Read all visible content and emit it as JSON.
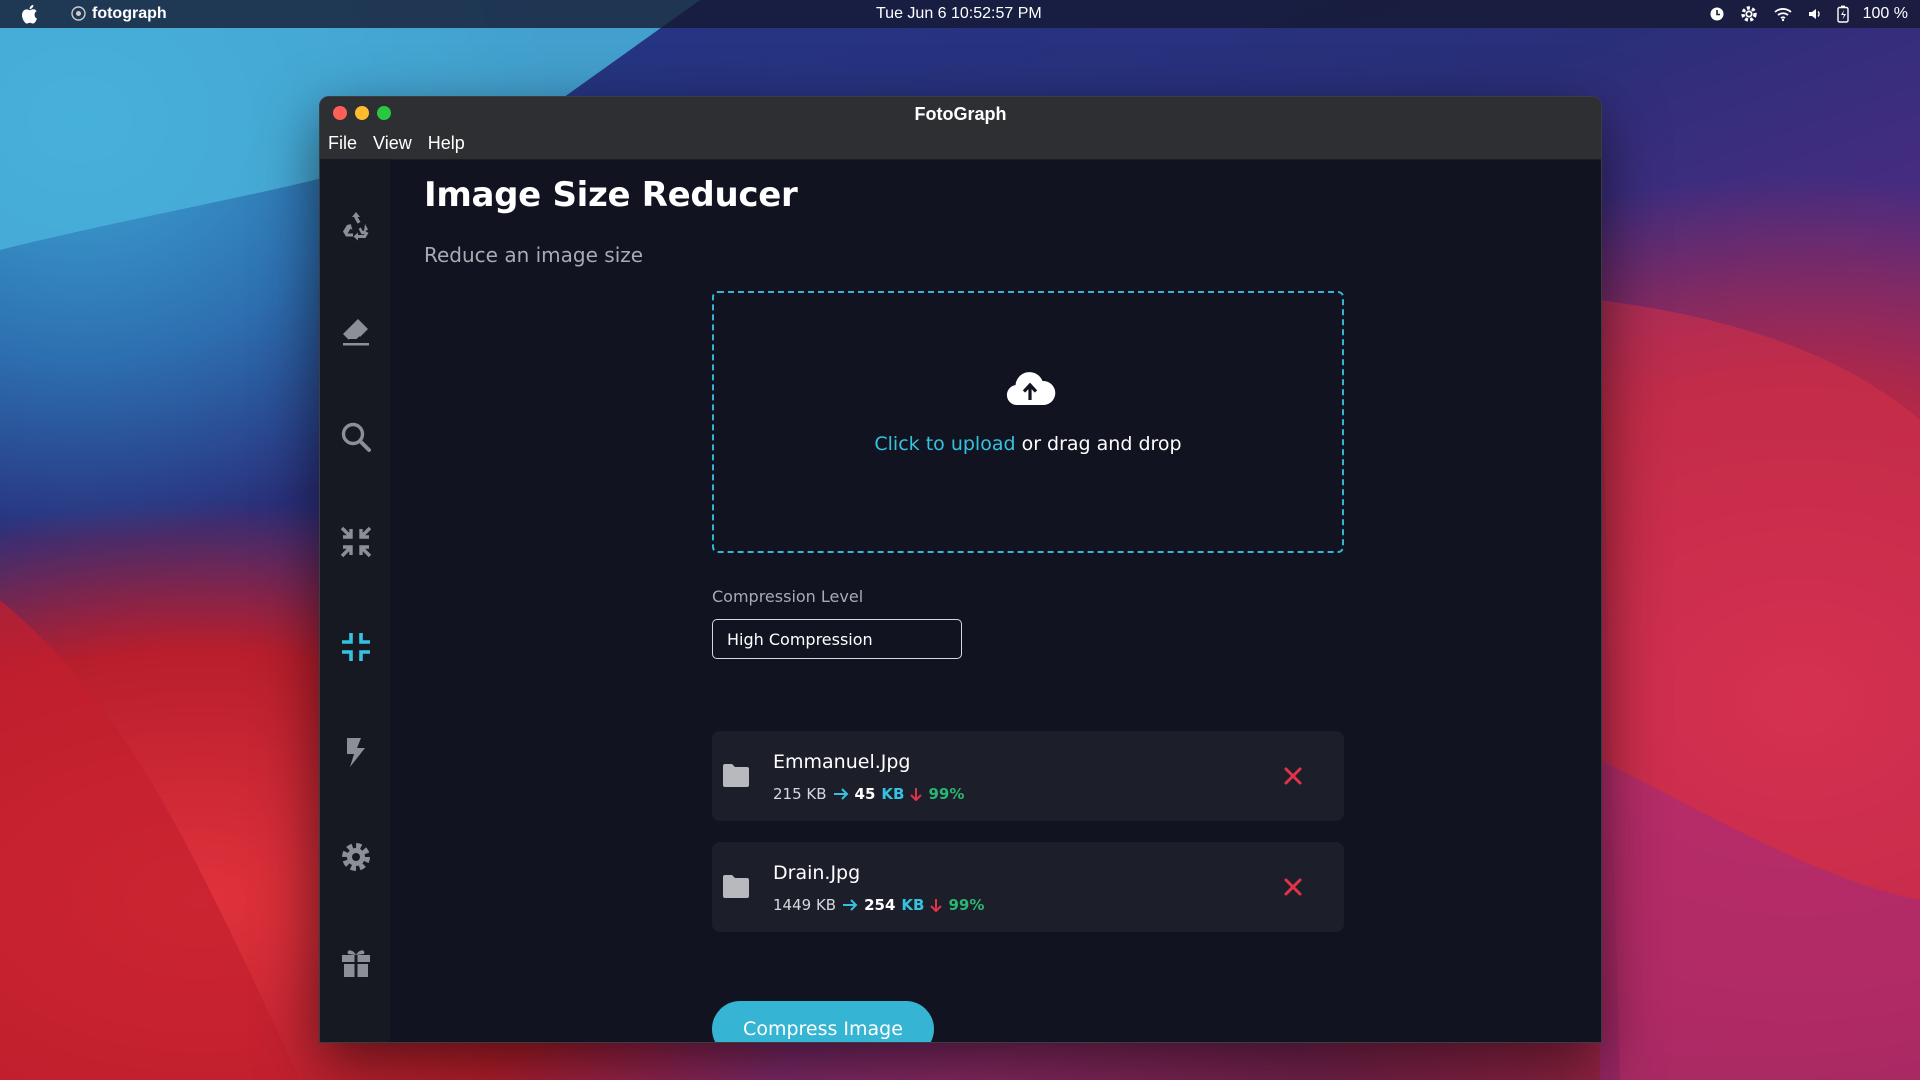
{
  "menubar": {
    "app_name": "fotograph",
    "clock": "Tue Jun 6  10:52:57 PM",
    "battery": "100 %",
    "icons": [
      "apple-icon",
      "clock-icon",
      "gear-icon",
      "wifi-icon",
      "volume-icon",
      "battery-icon"
    ]
  },
  "window": {
    "title": "FotoGraph",
    "menu": [
      "File",
      "View",
      "Help"
    ]
  },
  "sidebar": {
    "items": [
      {
        "icon": "recycle-icon",
        "active": false
      },
      {
        "icon": "eraser-icon",
        "active": false
      },
      {
        "icon": "search-icon",
        "active": false
      },
      {
        "icon": "compress-arrows-icon",
        "active": false
      },
      {
        "icon": "compress-icon",
        "active": true
      },
      {
        "icon": "bolt-icon",
        "active": false
      },
      {
        "icon": "gear-icon",
        "active": false
      },
      {
        "icon": "gift-icon",
        "active": false
      }
    ],
    "active_color": "#35c2e0"
  },
  "page": {
    "title": "Image Size Reducer",
    "subtitle": "Reduce an image size"
  },
  "upload": {
    "link_text": "Click to upload",
    "rest_text": " or drag and drop"
  },
  "compression": {
    "label": "Compression Level",
    "selected": "High Compression"
  },
  "files": [
    {
      "name": "Emmanuel.Jpg",
      "original": "215 KB",
      "new_size": "45",
      "unit": "KB",
      "reduction": "99%"
    },
    {
      "name": "Drain.Jpg",
      "original": "1449 KB",
      "new_size": "254",
      "unit": "KB",
      "reduction": "99%"
    }
  ],
  "actions": {
    "compress_label": "Compress Image"
  },
  "colors": {
    "accent": "#35c2e0",
    "success": "#2bb673",
    "danger": "#e0334a"
  }
}
